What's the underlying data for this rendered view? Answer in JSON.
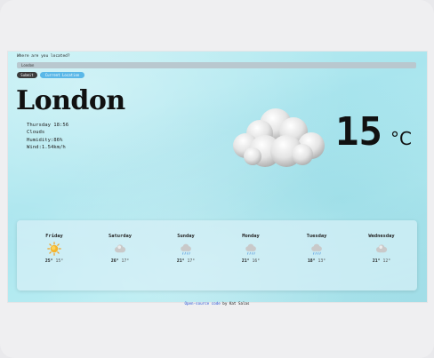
{
  "prompt": "Where are you located?",
  "search": {
    "value": "London"
  },
  "buttons": {
    "submit": "Submit",
    "current": "Current Location"
  },
  "current": {
    "city": "London",
    "day_time": "Thursday 18:56",
    "condition": "Clouds",
    "humidity": "Humidity:86%",
    "wind": "Wind:1.54km/h",
    "temperature": "15",
    "unit": "°C",
    "icon": "cloud-icon"
  },
  "forecast": [
    {
      "day": "Friday",
      "high": "25°",
      "low": "15°",
      "icon": "sun-icon"
    },
    {
      "day": "Saturday",
      "high": "26°",
      "low": "17°",
      "icon": "cloud-icon"
    },
    {
      "day": "Sunday",
      "high": "21°",
      "low": "17°",
      "icon": "rain-cloud-icon"
    },
    {
      "day": "Monday",
      "high": "21°",
      "low": "16°",
      "icon": "rain-cloud-icon"
    },
    {
      "day": "Tuesday",
      "high": "18°",
      "low": "13°",
      "icon": "rain-cloud-icon"
    },
    {
      "day": "Wednesday",
      "high": "21°",
      "low": "12°",
      "icon": "cloud-icon"
    }
  ],
  "footer": {
    "link": "Open-source code",
    "suffix": " by Kat Salas"
  },
  "colors": {
    "accent": "#5ab8e8",
    "background": "#b3e9f0"
  }
}
